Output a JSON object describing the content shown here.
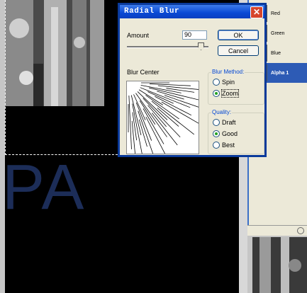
{
  "canvas": {
    "text": "PA"
  },
  "dialog": {
    "title": "Radial Blur",
    "amount_label": "Amount",
    "amount_value": "90",
    "amount_fraction": 0.9,
    "ok_label": "OK",
    "cancel_label": "Cancel",
    "blur_center_label": "Blur Center",
    "blur_method": {
      "title": "Blur Method:",
      "options": [
        "Spin",
        "Zoom"
      ],
      "selected": "Zoom"
    },
    "quality": {
      "title": "Quality:",
      "options": [
        "Draft",
        "Good",
        "Best"
      ],
      "selected": "Good"
    }
  },
  "channels": [
    {
      "label": "Red"
    },
    {
      "label": "Green"
    },
    {
      "label": "Blue"
    },
    {
      "label": "Alpha 1",
      "selected": true
    }
  ],
  "icons": {
    "close": "close-icon",
    "blur_center": "radial-zoom-preview-icon"
  }
}
